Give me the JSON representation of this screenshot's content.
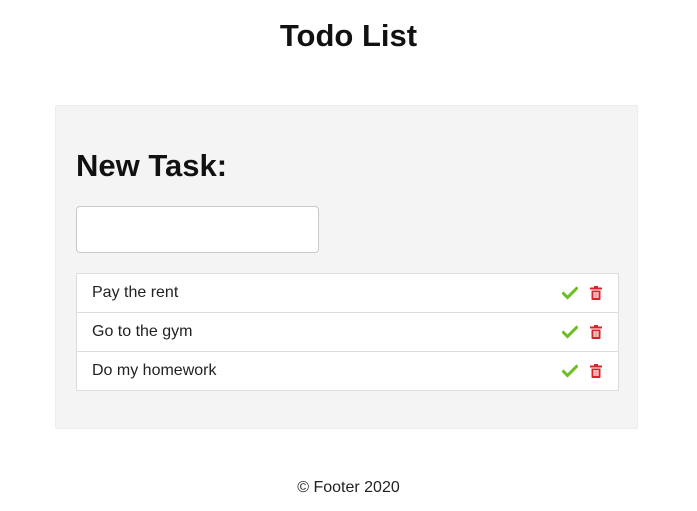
{
  "header": {
    "title": "Todo List"
  },
  "form": {
    "heading": "New Task:",
    "input_value": "",
    "input_placeholder": ""
  },
  "tasks": [
    {
      "text": "Pay the rent"
    },
    {
      "text": "Go to the gym"
    },
    {
      "text": "Do my homework"
    }
  ],
  "icons": {
    "complete": "check-icon",
    "delete": "trash-icon"
  },
  "colors": {
    "complete": "#6bbf20",
    "delete": "#d8232a",
    "panel_background": "#f4f4f4"
  },
  "footer": {
    "text": "© Footer 2020"
  }
}
